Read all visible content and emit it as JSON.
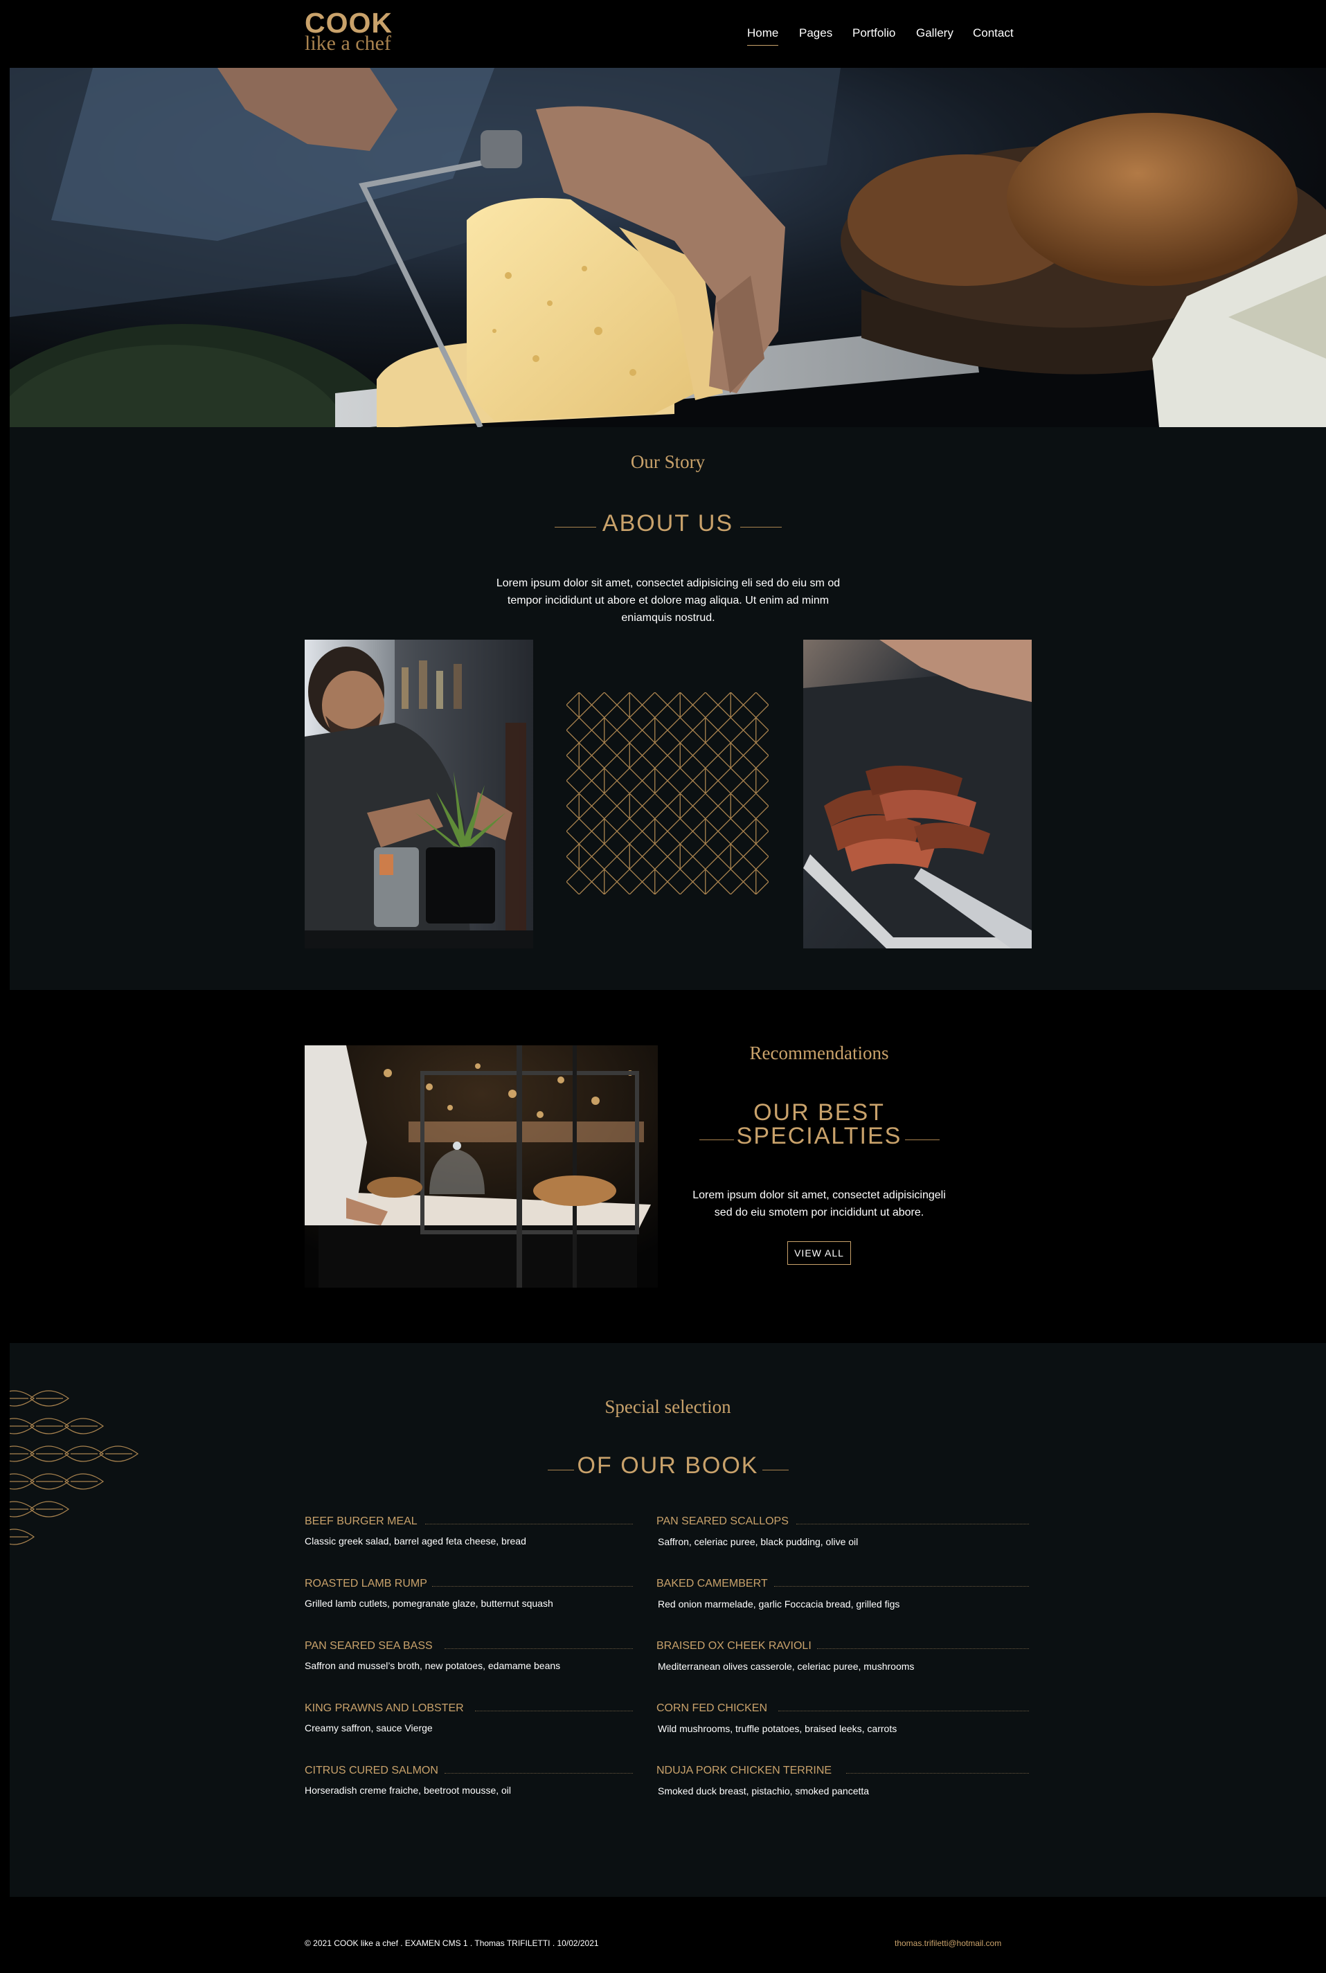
{
  "brand": {
    "name": "COOK",
    "tagline": "like a chef"
  },
  "nav": {
    "items": [
      {
        "label": "Home",
        "active": true
      },
      {
        "label": "Pages"
      },
      {
        "label": "Portfolio"
      },
      {
        "label": "Gallery"
      },
      {
        "label": "Contact"
      }
    ]
  },
  "about": {
    "kicker": "Our Story",
    "heading": "ABOUT US",
    "text_line1": "Lorem ipsum dolor sit amet, consectet adipisicing eli sed do eiu sm od",
    "text_line2": "tempor incididunt ut abore et dolore mag aliqua. Ut enim ad minm",
    "text_line3": "eniamquis nostrud."
  },
  "specialties": {
    "kicker": "Recommendations",
    "heading_line1": "OUR BEST",
    "heading_line2": "SPECIALTIES",
    "text_line1": "Lorem ipsum dolor sit amet, consectet adipisicingeli",
    "text_line2": "sed do eiu smotem por incididunt ut abore.",
    "button": "VIEW ALL"
  },
  "menu": {
    "kicker": "Special selection",
    "heading": "OF OUR BOOK",
    "left": [
      {
        "title": "BEEF BURGER MEAL",
        "desc": "Classic greek salad, barrel aged feta cheese, bread"
      },
      {
        "title": "ROASTED LAMB RUMP",
        "desc": "Grilled lamb cutlets, pomegranate glaze, butternut squash"
      },
      {
        "title": "PAN SEARED SEA BASS",
        "desc": "Saffron and mussel’s broth, new potatoes, edamame beans"
      },
      {
        "title": "KING PRAWNS AND LOBSTER",
        "desc": "Creamy saffron, sauce Vierge"
      },
      {
        "title": "CITRUS CURED SALMON",
        "desc": "Horseradish creme fraiche, beetroot mousse, oil"
      }
    ],
    "right": [
      {
        "title": "PAN SEARED SCALLOPS",
        "desc": "Saffron, celeriac puree, black pudding, olive oil"
      },
      {
        "title": "BAKED CAMEMBERT",
        "desc": "Red onion marmelade, garlic Foccacia bread, grilled figs"
      },
      {
        "title": "BRAISED OX CHEEK RAVIOLI",
        "desc": "Mediterranean olives casserole, celeriac puree, mushrooms"
      },
      {
        "title": "CORN FED CHICKEN",
        "desc": "Wild mushrooms, truffle potatoes, braised leeks, carrots"
      },
      {
        "title": "NDUJA PORK CHICKEN TERRINE",
        "desc": "Smoked duck breast, pistachio, smoked pancetta"
      }
    ]
  },
  "footer": {
    "copyright": "© 2021 COOK like a chef . EXAMEN CMS 1 . Thomas TRIFILETTI . 10/02/2021",
    "email": "thomas.trifiletti@hotmail.com"
  },
  "colors": {
    "accent": "#c9a26b",
    "background": "#000000",
    "section": "#0b1012"
  },
  "icons": [
    "geometric-pattern-icon",
    "leaf-pattern-icon"
  ]
}
